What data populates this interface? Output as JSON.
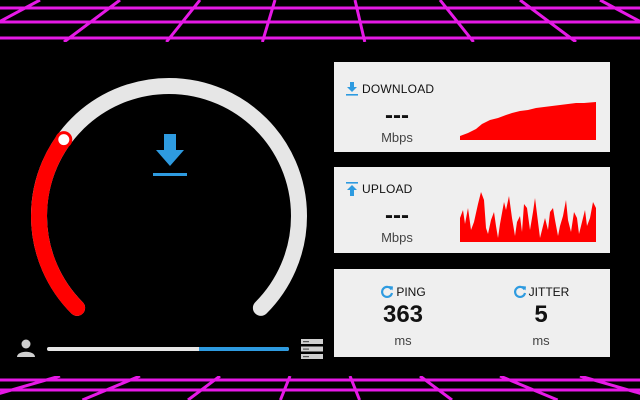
{
  "colors": {
    "background": "#000000",
    "grid": "#e619e6",
    "accent": "#2e9be0",
    "gauge_active": "#ff0000",
    "gauge_track": "#e6e6e6",
    "card_bg": "#efefef",
    "chart_fill": "#ff0000"
  },
  "gauge": {
    "level": 0.3,
    "center_icon": "download-arrow-icon"
  },
  "progress": {
    "fraction": 0.37,
    "left_icon": "user-icon",
    "right_icon": "server-icon"
  },
  "download": {
    "icon": "download-arrow-icon",
    "label": "DOWNLOAD",
    "value": "---",
    "unit": "Mbps"
  },
  "upload": {
    "icon": "upload-arrow-icon",
    "label": "UPLOAD",
    "value": "---",
    "unit": "Mbps"
  },
  "ping": {
    "icon": "refresh-icon",
    "label": "PING",
    "value": "363",
    "unit": "ms"
  },
  "jitter": {
    "icon": "refresh-icon",
    "label": "JITTER",
    "value": "5",
    "unit": "ms"
  }
}
